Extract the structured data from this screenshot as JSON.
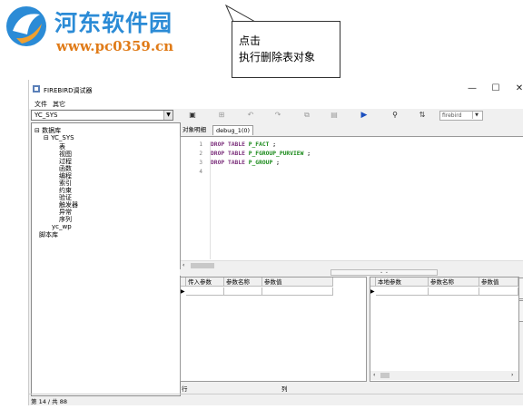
{
  "watermark": {
    "title": "河东软件园",
    "url": "www.pc0359.cn"
  },
  "callout": {
    "line1": "点击",
    "line2": "执行删除表对象"
  },
  "window": {
    "title": "FIREBIRD调试器",
    "controls": {
      "minimize": "—",
      "maximize": "☐",
      "close": "✕"
    }
  },
  "menu": [
    "文件",
    "其它"
  ],
  "schema_select": {
    "value": "YC_SYS"
  },
  "toolbar": {
    "db_select": "firebird",
    "icons": [
      "new-icon",
      "cut-icon",
      "undo-icon",
      "redo-icon",
      "copy-icon",
      "paste-icon",
      "run-icon",
      "find-icon",
      "replace-icon"
    ]
  },
  "tree": {
    "root": "数据库",
    "schema": "YC_SYS",
    "children": [
      "表",
      "视图",
      "过程",
      "函数",
      "编程",
      "索引",
      "约束",
      "验证",
      "触发器",
      "异常",
      "序列"
    ],
    "other": "yc_wp",
    "scripts": "脚本库"
  },
  "tabs": [
    "对象明细",
    "debug_1(0)"
  ],
  "editor": {
    "lines": [
      {
        "n": "1",
        "kw": "DROP TABLE",
        "obj": "P_FACT",
        "end": ";"
      },
      {
        "n": "2",
        "kw": "DROP TABLE",
        "obj": "P_FGROUP_PURVIEW",
        "end": ";"
      },
      {
        "n": "3",
        "kw": "DROP TABLE",
        "obj": "P_GROUP",
        "end": ";"
      },
      {
        "n": "4",
        "kw": "",
        "obj": "",
        "end": ""
      }
    ]
  },
  "grid_in": {
    "headers": [
      "传入参数",
      "参数名称",
      "参数值"
    ],
    "row_marker": "▶"
  },
  "grid_local": {
    "headers": [
      "本地参数",
      "参数名称",
      "参数值"
    ],
    "row_marker": "▶"
  },
  "position": {
    "row_label": "行",
    "col_label": "列"
  },
  "status": {
    "text": "第 14 / 共 88"
  },
  "colors": {
    "keyword": "#7b2f7b",
    "object": "#1a8a1a",
    "watermark_blue": "#2b8bd6",
    "watermark_orange": "#e07b18"
  }
}
